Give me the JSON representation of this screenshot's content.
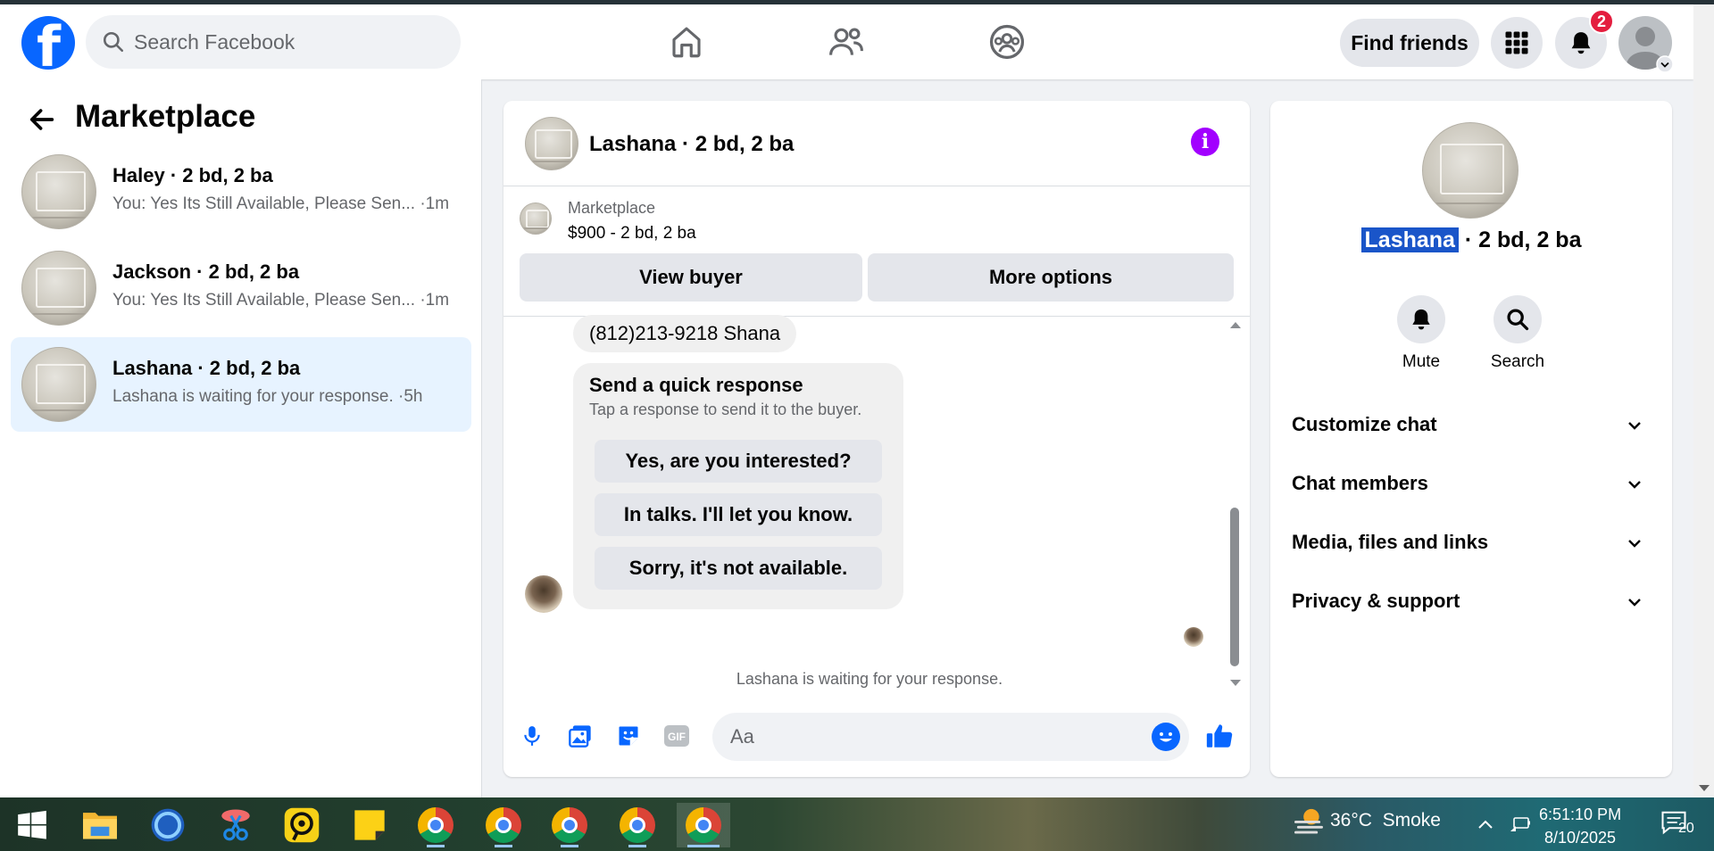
{
  "header": {
    "logo_letter": "f",
    "search_placeholder": "Search Facebook",
    "find_friends": "Find friends",
    "notification_count": "2"
  },
  "sidebar": {
    "title": "Marketplace",
    "conversations": [
      {
        "name": "Haley · 2 bd, 2 ba",
        "snippet": "You: Yes Its Still Available, Please Sen... ·1m"
      },
      {
        "name": "Jackson · 2 bd, 2 ba",
        "snippet": "You: Yes Its Still Available, Please Sen... ·1m"
      },
      {
        "name": "Lashana · 2 bd, 2 ba",
        "snippet": "Lashana is waiting for your response. ·5h"
      }
    ]
  },
  "chat": {
    "title": "Lashana · 2 bd, 2 ba",
    "listing_source": "Marketplace",
    "listing_price": "$900 - 2 bd, 2 ba",
    "view_buyer": "View buyer",
    "more_options": "More options",
    "phone_message": "(812)213-9218 Shana",
    "quick_response_title": "Send a quick response",
    "quick_response_subtitle": "Tap a response to send it to the buyer.",
    "quick_responses": [
      "Yes, are you interested?",
      "In talks. I'll let you know.",
      "Sorry, it's not available."
    ],
    "waiting_text": "Lashana is waiting for your response.",
    "composer_placeholder": "Aa",
    "gif_label": "GIF"
  },
  "details": {
    "name_highlight": "Lashana",
    "name_rest": " · 2 bd, 2 ba",
    "mute": "Mute",
    "search": "Search",
    "sections": [
      "Customize chat",
      "Chat members",
      "Media, files and links",
      "Privacy & support"
    ]
  },
  "taskbar": {
    "temperature": "36°C",
    "weather": "Smoke",
    "time": "6:51:10 PM",
    "date": "8/10/2025",
    "notifications": "20"
  },
  "colors": {
    "brand": "#0866ff",
    "info": "#a200ff",
    "active_conversation": "#e7f3ff",
    "badge": "#e41e3f"
  }
}
